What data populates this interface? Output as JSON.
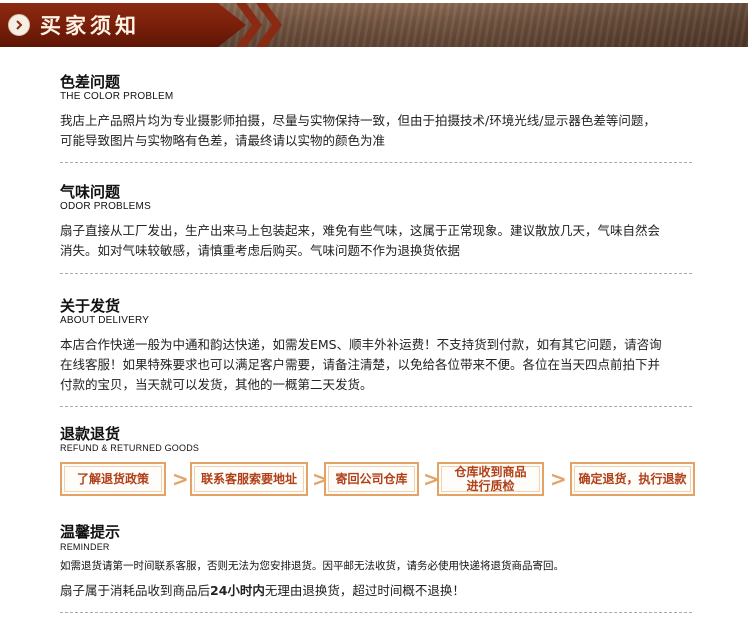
{
  "header": {
    "title": "买家须知",
    "icon": "chevron-right-icon"
  },
  "sections": [
    {
      "title": "色差问题",
      "subtitle": "THE COLOR PROBLEM",
      "body": "我店上产品照片均为专业摄影师拍摄，尽量与实物保持一致，但由于拍摄技术/环境光线/显示器色差等问题，可能导致图片与实物略有色差，请最终请以实物的颜色为准"
    },
    {
      "title": "气味问题",
      "subtitle": "ODOR PROBLEMS",
      "body": "扇子直接从工厂发出，生产出来马上包装起来，难免有些气味，这属于正常现象。建议散放几天，气味自然会消失。如对气味较敏感，请慎重考虑后购买。气味问题不作为退换货依据"
    },
    {
      "title": "关于发货",
      "subtitle": "ABOUT DELIVERY",
      "body": "本店合作快递一般为中通和韵达快递，如需发EMS、顺丰外补运费！不支持货到付款，如有其它问题，请咨询在线客服！如果特殊要求也可以满足客户需要，请备注清楚，以免给各位带来不便。各位在当天四点前拍下并付款的宝贝，当天就可以发货，其他的一概第二天发货。"
    }
  ],
  "refund": {
    "title": "退款退货",
    "subtitle": "REFUND & RETURNED GOODS",
    "steps": [
      "了解退货政策",
      "联系客服索要地址",
      "寄回公司仓库",
      "仓库收到商品\n进行质检",
      "确定退货，执行退款"
    ],
    "arrow": ">"
  },
  "reminder": {
    "title": "温馨提示",
    "subtitle": "REMINDER",
    "line1": "如需退货请第一时间联系客服，否则无法为您安排退货。因平邮无法收货，请务必使用快递将退货商品寄回。",
    "line2_pre": "扇子属于消耗品收到商品后",
    "line2_bold": "24小时内",
    "line2_post": "无理由退换货，超过时间概不退换！"
  },
  "colors": {
    "banner_red": "#7a1f0a",
    "step_border": "#e4a366",
    "step_text": "#b0401a"
  }
}
